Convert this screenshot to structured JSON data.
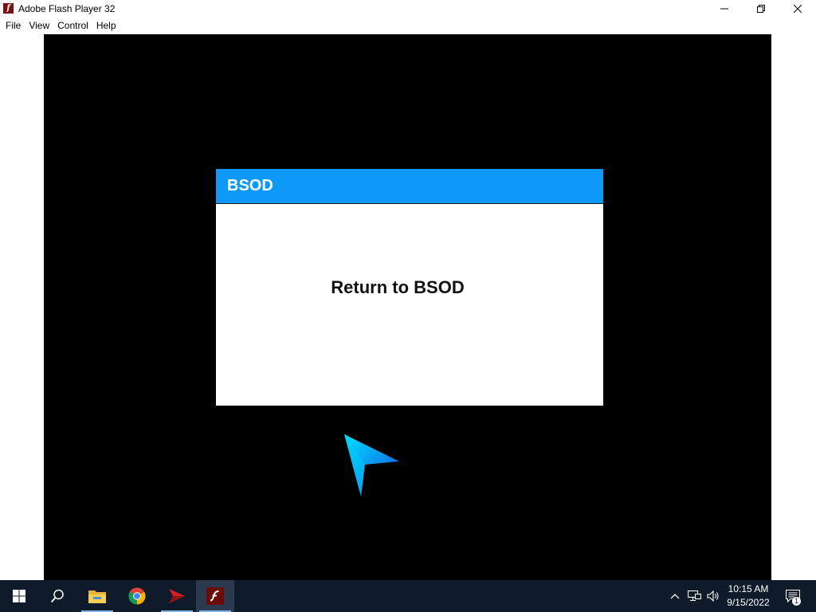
{
  "window": {
    "title": "Adobe Flash Player 32",
    "app_icon": "flash-player-icon",
    "app_icon_glyph": "f",
    "controls": [
      "minimize-icon",
      "restore-icon",
      "close-icon"
    ]
  },
  "menu": [
    "File",
    "View",
    "Control",
    "Help"
  ],
  "stage": {
    "background": "#000000",
    "dialog": {
      "title": "BSOD",
      "header_color": "#0d99f7",
      "button_label": "Return to BSOD"
    },
    "decoration": "blue-arrow-cursor"
  },
  "taskbar": {
    "background": "#0f1b2a",
    "apps": [
      "start-icon",
      "search-icon",
      "file-explorer-icon",
      "chrome-icon",
      "red-arrow-app-icon",
      "flash-player-icon"
    ],
    "tray_icons": [
      "chevron-up-icon",
      "network-icon",
      "volume-icon",
      "notification-icon"
    ],
    "time": "10:15 AM",
    "date": "9/15/2022",
    "notification_count": "1"
  }
}
